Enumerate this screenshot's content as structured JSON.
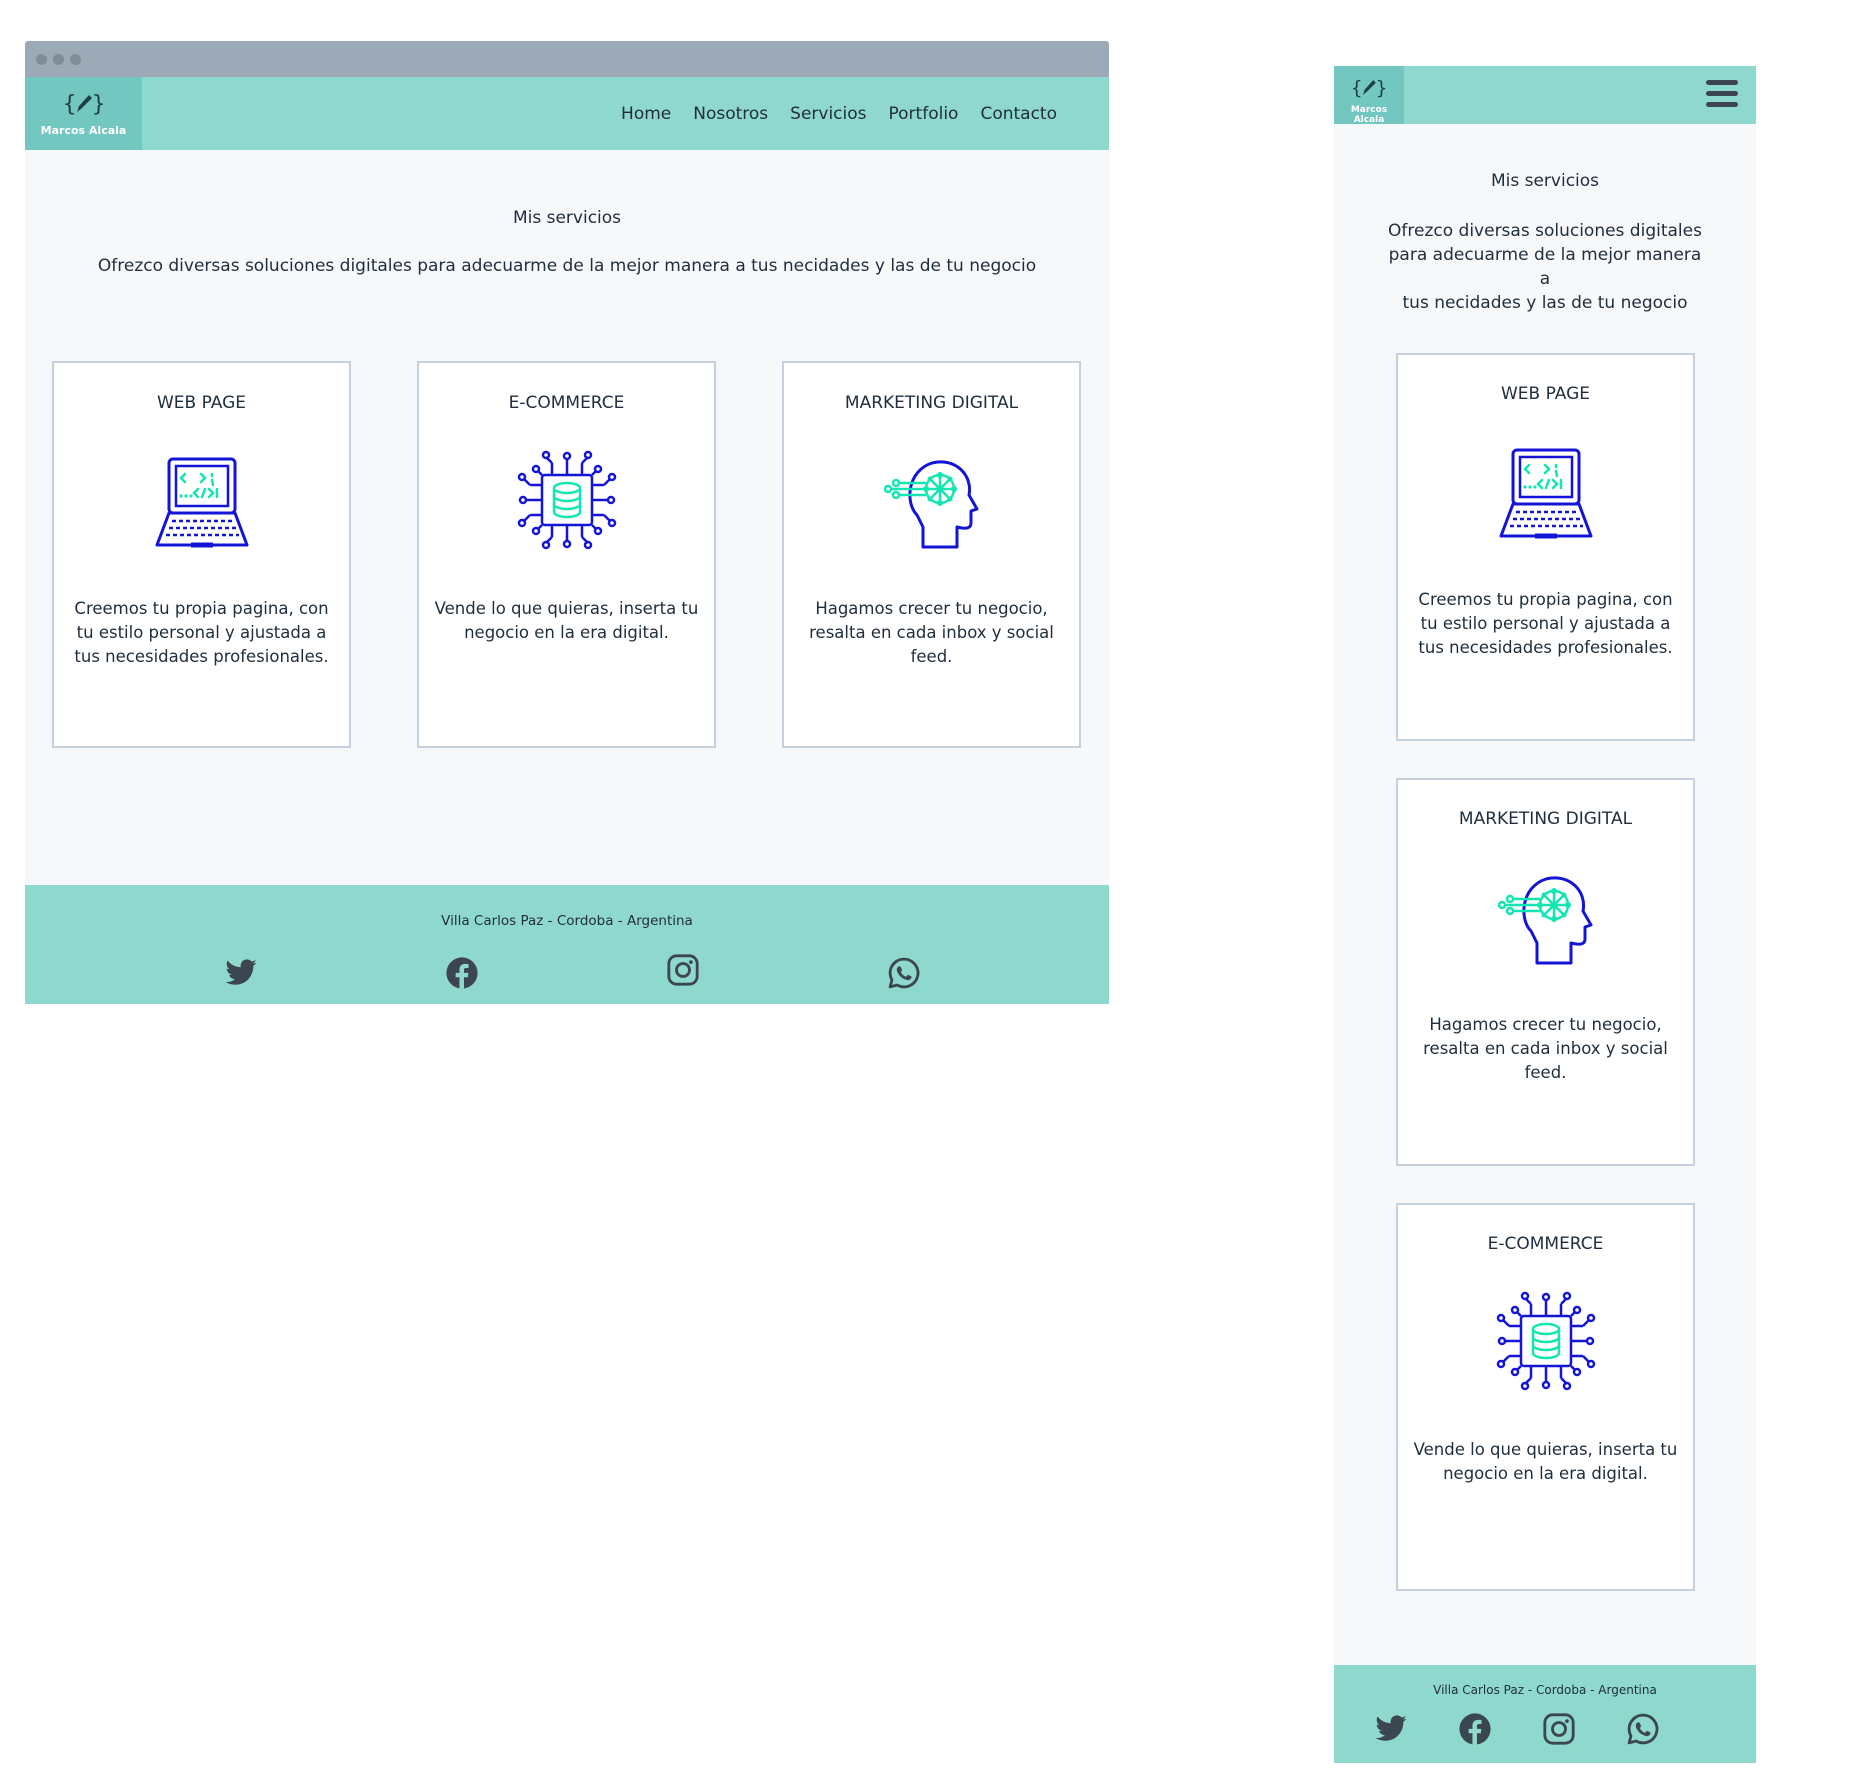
{
  "brand": {
    "name": "Marcos Alcala",
    "logo_icon": "pencil-braces-icon"
  },
  "nav": {
    "items": [
      "Home",
      "Nosotros",
      "Servicios",
      "Portfolio",
      "Contacto"
    ]
  },
  "services": {
    "title": "Mis servicios",
    "intro": "Ofrezco diversas soluciones digitales para adecuarme de la mejor manera a tus necidades y las de tu negocio",
    "intro_mobile_lines": [
      "Ofrezco diversas soluciones digitales",
      "para adecuarme de la mejor manera a",
      "tus necidades y las de tu negocio"
    ],
    "web": {
      "title": "WEB PAGE",
      "icon": "laptop-code-icon",
      "text": "Creemos tu propia pagina, con tu estilo personal y ajustada a tus necesidades profesionales."
    },
    "ecommerce": {
      "title": "E-COMMERCE",
      "icon": "database-circuit-icon",
      "text": "Vende lo que quieras, inserta tu negocio en la era digital."
    },
    "marketing": {
      "title": "MARKETING DIGITAL",
      "icon": "head-network-icon",
      "text": "Hagamos crecer tu negocio, resalta en cada inbox y social feed."
    }
  },
  "footer": {
    "address": "Villa Carlos Paz - Cordoba - Argentina",
    "social": [
      "twitter-icon",
      "facebook-icon",
      "instagram-icon",
      "whatsapp-icon"
    ]
  },
  "colors": {
    "navbar": "#8fd8cd",
    "logo_bg": "#72c8c0",
    "icon_blue": "#1414d6",
    "icon_mint": "#13e6b1",
    "card_border": "#c5d1de",
    "page_bg": "#f7f8fa",
    "social_icon": "#3b4650"
  }
}
